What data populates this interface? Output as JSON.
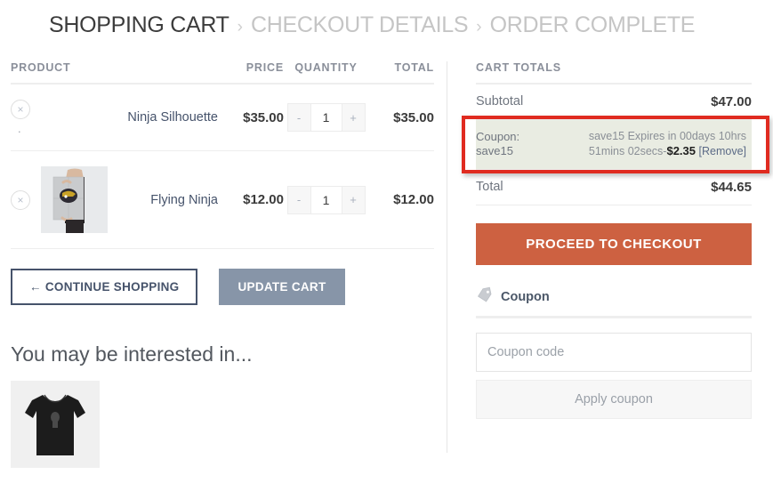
{
  "breadcrumb": {
    "separator": "›",
    "steps": [
      {
        "label": "SHOPPING CART",
        "state": "active"
      },
      {
        "label": "CHECKOUT DETAILS",
        "state": "inactive"
      },
      {
        "label": "ORDER COMPLETE",
        "state": "inactive"
      }
    ]
  },
  "cart": {
    "headers": {
      "product": "PRODUCT",
      "price": "PRICE",
      "quantity": "QUANTITY",
      "total": "TOTAL"
    },
    "remove_icon": "×",
    "decrement_label": "-",
    "increment_label": "+",
    "items": [
      {
        "name": "Ninja Silhouette",
        "price": "$35.00",
        "quantity": "1",
        "total": "$35.00",
        "thumb": "none",
        "trailing_mark": "."
      },
      {
        "name": "Flying Ninja",
        "price": "$12.00",
        "quantity": "1",
        "total": "$12.00",
        "thumb": "flying-ninja-poster",
        "trailing_mark": ""
      }
    ],
    "continue_label": "← CONTINUE SHOPPING",
    "update_label": "UPDATE CART"
  },
  "upsell": {
    "title": "You may be interested in...",
    "items": [
      {
        "thumb": "black-tshirt"
      }
    ]
  },
  "totals": {
    "title": "CART TOTALS",
    "subtotal_label": "Subtotal",
    "subtotal_value": "$47.00",
    "coupon_label": "Coupon:",
    "coupon_code": "save15",
    "coupon_expiry_line1": "save15  Expires in 00days 10hrs",
    "coupon_expiry_line2": "51mins 02secs-",
    "coupon_discount": "$2.35",
    "coupon_remove": "[Remove]",
    "total_label": "Total",
    "total_value": "$44.65",
    "checkout_label": "PROCEED TO CHECKOUT"
  },
  "coupon_form": {
    "heading": "Coupon",
    "icon": "tag-icon",
    "input_value": "",
    "input_placeholder": "Coupon code",
    "apply_label": "Apply coupon"
  },
  "colors": {
    "accent_orange": "#cd6141",
    "highlight_red": "#e02b20",
    "coupon_bg": "#e9ece2",
    "link_blue": "#46536b",
    "update_gray": "#8795a8"
  }
}
